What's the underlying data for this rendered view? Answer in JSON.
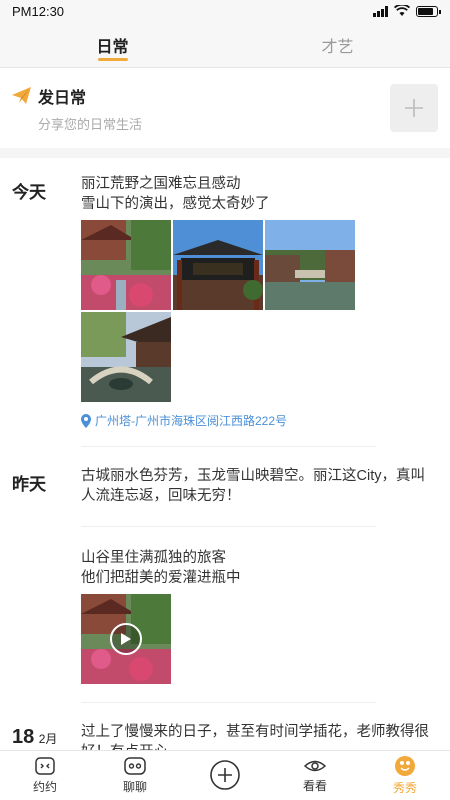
{
  "status_bar": {
    "time": "PM12:30"
  },
  "tabs": [
    {
      "label": "日常",
      "active": true
    },
    {
      "label": "才艺",
      "active": false
    }
  ],
  "post": {
    "title": "发日常",
    "subtitle": "分享您的日常生活",
    "icon": "paper-plane-icon",
    "add_icon": "plus-icon"
  },
  "feed": {
    "today": {
      "label": "今天",
      "text_line1": "丽江荒野之国难忘且感动",
      "text_line2": "雪山下的演出，感觉太奇妙了",
      "photo_count": 4,
      "location": "广州塔-广州市海珠区阅江西路222号"
    },
    "yesterday": {
      "label": "昨天",
      "entry1": "古城丽水色芬芳，玉龙雪山映碧空。丽江这City，真叫人流连忘返，回味无穷！",
      "entry2_line1": "山谷里住满孤独的旅客",
      "entry2_line2": "他们把甜美的爱灌进瓶中"
    },
    "date_entry": {
      "day": "18",
      "month": "2月",
      "text": "过上了慢慢来的日子，甚至有时间学插花，老师教得很好！有点开心"
    }
  },
  "bottom_nav": [
    {
      "label": "约约",
      "icon": "calendar-face-icon",
      "active": false
    },
    {
      "label": "聊聊",
      "icon": "chat-face-icon",
      "active": false
    },
    {
      "label": "",
      "icon": "add-circle-icon",
      "active": false
    },
    {
      "label": "看看",
      "icon": "eye-icon",
      "active": false
    },
    {
      "label": "秀秀",
      "icon": "show-badge-icon",
      "active": true
    }
  ],
  "colors": {
    "accent": "#f2a93b",
    "location": "#4a8fd8"
  }
}
